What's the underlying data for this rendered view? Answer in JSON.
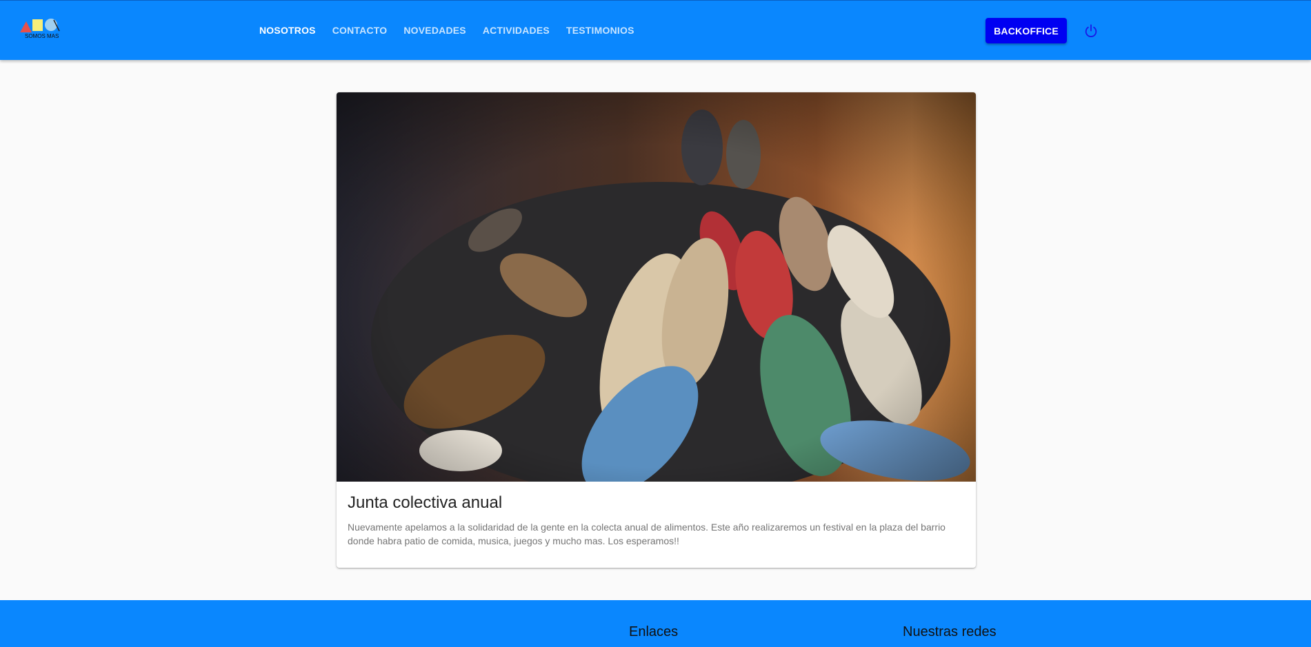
{
  "header": {
    "logo_text": "SOMOS MAS",
    "nav": [
      {
        "label": "NOSOTROS",
        "active": true
      },
      {
        "label": "CONTACTO",
        "active": false
      },
      {
        "label": "NOVEDADES",
        "active": false
      },
      {
        "label": "ACTIVIDADES",
        "active": false
      },
      {
        "label": "TESTIMONIOS",
        "active": false
      }
    ],
    "backoffice_label": "BACKOFFICE",
    "power_icon": "power-icon"
  },
  "card": {
    "image_icon": "sneakers-photo",
    "title": "Junta colectiva anual",
    "text": "Nuevamente apelamos a la solidaridad de la gente en la colecta anual de alimentos. Este año realizaremos un festival en la plaza del barrio donde habra patio de comida, musica, juegos y mucho mas. Los esperamos!!"
  },
  "footer": {
    "links_heading": "Enlaces",
    "social_heading": "Nuestras redes"
  },
  "colors": {
    "primary": "#0a87fe",
    "button": "#0000f2",
    "background": "#fafafa"
  }
}
